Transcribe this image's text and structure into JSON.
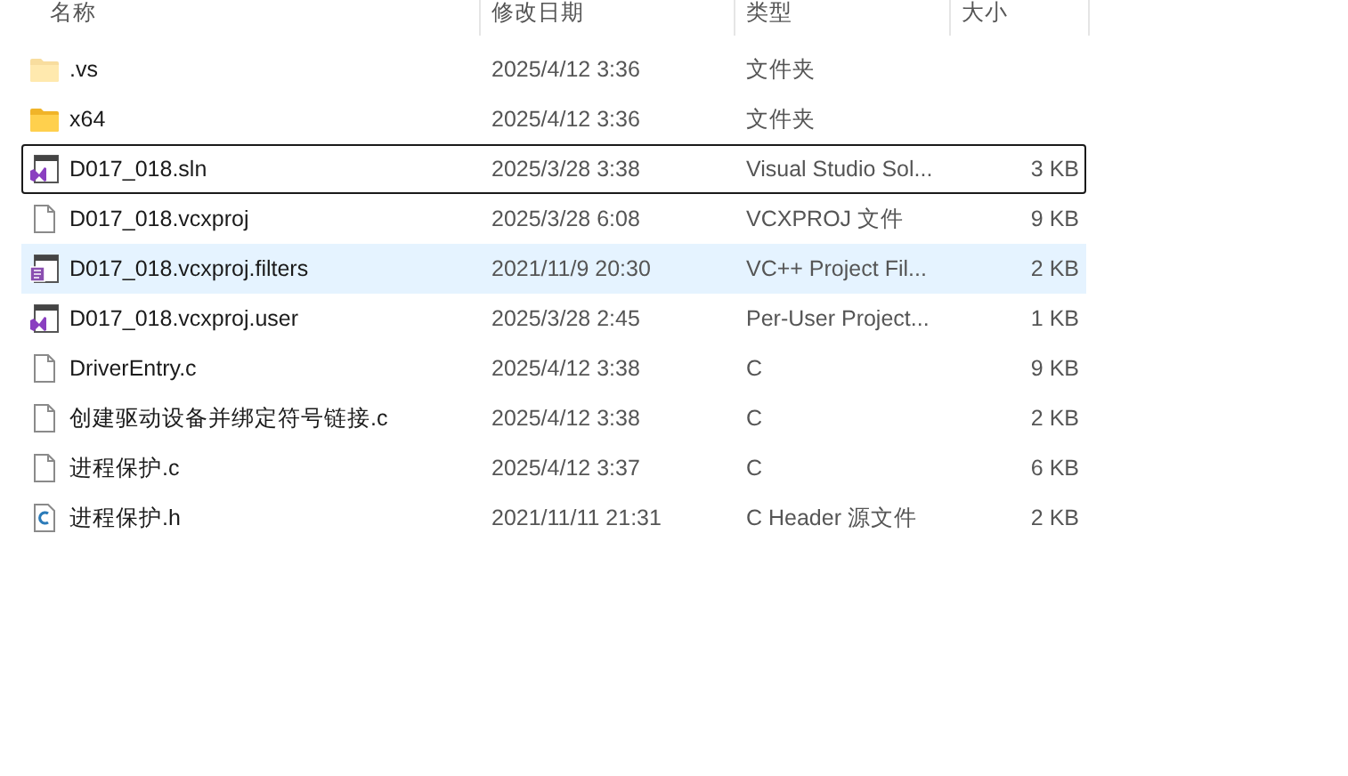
{
  "columns": [
    {
      "label": "名称"
    },
    {
      "label": "修改日期"
    },
    {
      "label": "类型"
    },
    {
      "label": "大小"
    }
  ],
  "rows": [
    {
      "kind": "folder",
      "hidden": true,
      "name": ".vs",
      "modified": "2025/4/12 3:36",
      "type": "文件夹",
      "focused": false,
      "highlighted": false
    },
    {
      "kind": "folder",
      "hidden": false,
      "name": "x64",
      "modified": "2025/4/12 3:36",
      "type": "文件夹",
      "focused": false,
      "highlighted": false
    },
    {
      "kind": "solution",
      "hidden": false,
      "name": "D017_018.sln",
      "modified": "2025/3/28 3:38",
      "type": "Visual Studio Sol...",
      "size": "3 KB",
      "focused": true,
      "highlighted": false
    },
    {
      "kind": "file",
      "hidden": false,
      "name": "D017_018.vcxproj",
      "modified": "2025/3/28 6:08",
      "type": "VCXPROJ 文件",
      "size": "9 KB",
      "focused": false,
      "highlighted": false
    },
    {
      "kind": "filters",
      "hidden": false,
      "name": "D017_018.vcxproj.filters",
      "modified": "2021/11/9 20:30",
      "type": "VC++ Project Fil...",
      "size": "2 KB",
      "focused": false,
      "highlighted": true
    },
    {
      "kind": "user",
      "hidden": false,
      "name": "D017_018.vcxproj.user",
      "modified": "2025/3/28 2:45",
      "type": "Per-User Project...",
      "size": "1 KB",
      "focused": false,
      "highlighted": false
    },
    {
      "kind": "file",
      "hidden": false,
      "name": "DriverEntry.c",
      "modified": "2025/4/12 3:38",
      "type": "C",
      "size": "9 KB",
      "focused": false,
      "highlighted": false
    },
    {
      "kind": "file",
      "hidden": false,
      "name": "创建驱动设备并绑定符号链接.c",
      "modified": "2025/4/12 3:38",
      "type": "C",
      "size": "2 KB",
      "focused": false,
      "highlighted": false
    },
    {
      "kind": "file",
      "hidden": false,
      "name": "进程保护.c",
      "modified": "2025/4/12 3:37",
      "type": "C",
      "size": "6 KB",
      "focused": false,
      "highlighted": false
    },
    {
      "kind": "c-header",
      "hidden": false,
      "name": "进程保护.h",
      "modified": "2021/11/11 21:31",
      "type": "C Header 源文件",
      "size": "2 KB",
      "focused": false,
      "highlighted": false
    }
  ]
}
